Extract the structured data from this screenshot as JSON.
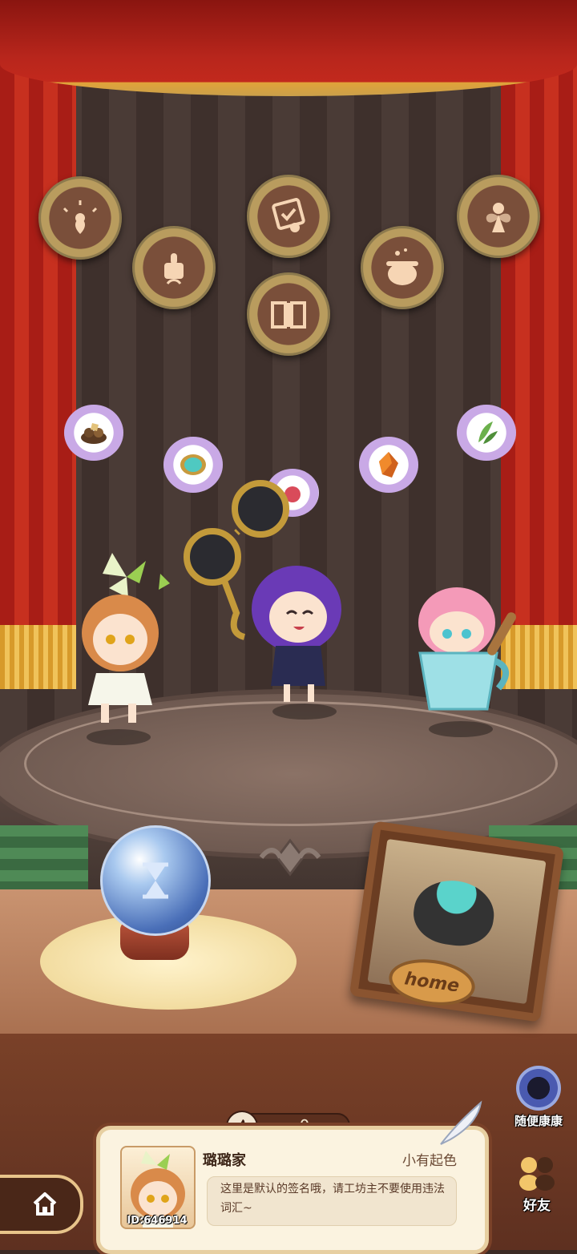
{
  "room": {
    "home_sign": "home"
  },
  "medallions": [
    {
      "icon": "sprout-sparkle-icon"
    },
    {
      "icon": "certificate-icon"
    },
    {
      "icon": "fairy-icon"
    },
    {
      "icon": "thumbs-up-sprout-icon"
    },
    {
      "icon": "cauldron-icon"
    },
    {
      "icon": "spellbook-icon"
    }
  ],
  "materials": [
    {
      "icon": "ore-pile-icon"
    },
    {
      "icon": "teal-gem-icon"
    },
    {
      "icon": "amber-crystal-icon"
    },
    {
      "icon": "herb-leaf-icon"
    }
  ],
  "like": {
    "count": "0"
  },
  "random_visit": {
    "label": "随便康康"
  },
  "profile": {
    "name": "璐璐家",
    "title": "小有起色",
    "id": "ID:646914",
    "signature": "这里是默认的签名哦，请工坊主不要使用违法词汇~"
  },
  "nav": {
    "friends_label": "好友"
  },
  "colors": {
    "curtain": "#b8261c",
    "stage": "#6f5a51",
    "card": "#fbf3e0",
    "accent_gold": "#e8c48a"
  }
}
